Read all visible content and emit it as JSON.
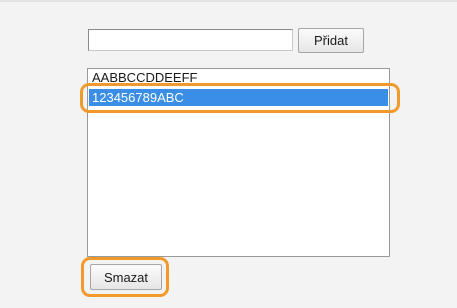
{
  "form": {
    "input_value": "",
    "add_label": "Přidat",
    "list_items": [
      "AABBCCDDEEFF",
      "123456789ABC"
    ],
    "selected_index": 1,
    "delete_label": "Smazat"
  },
  "colors": {
    "selection": "#3a8ee6",
    "highlight": "#f19a2c",
    "panel_bg": "#f3f3f3"
  }
}
